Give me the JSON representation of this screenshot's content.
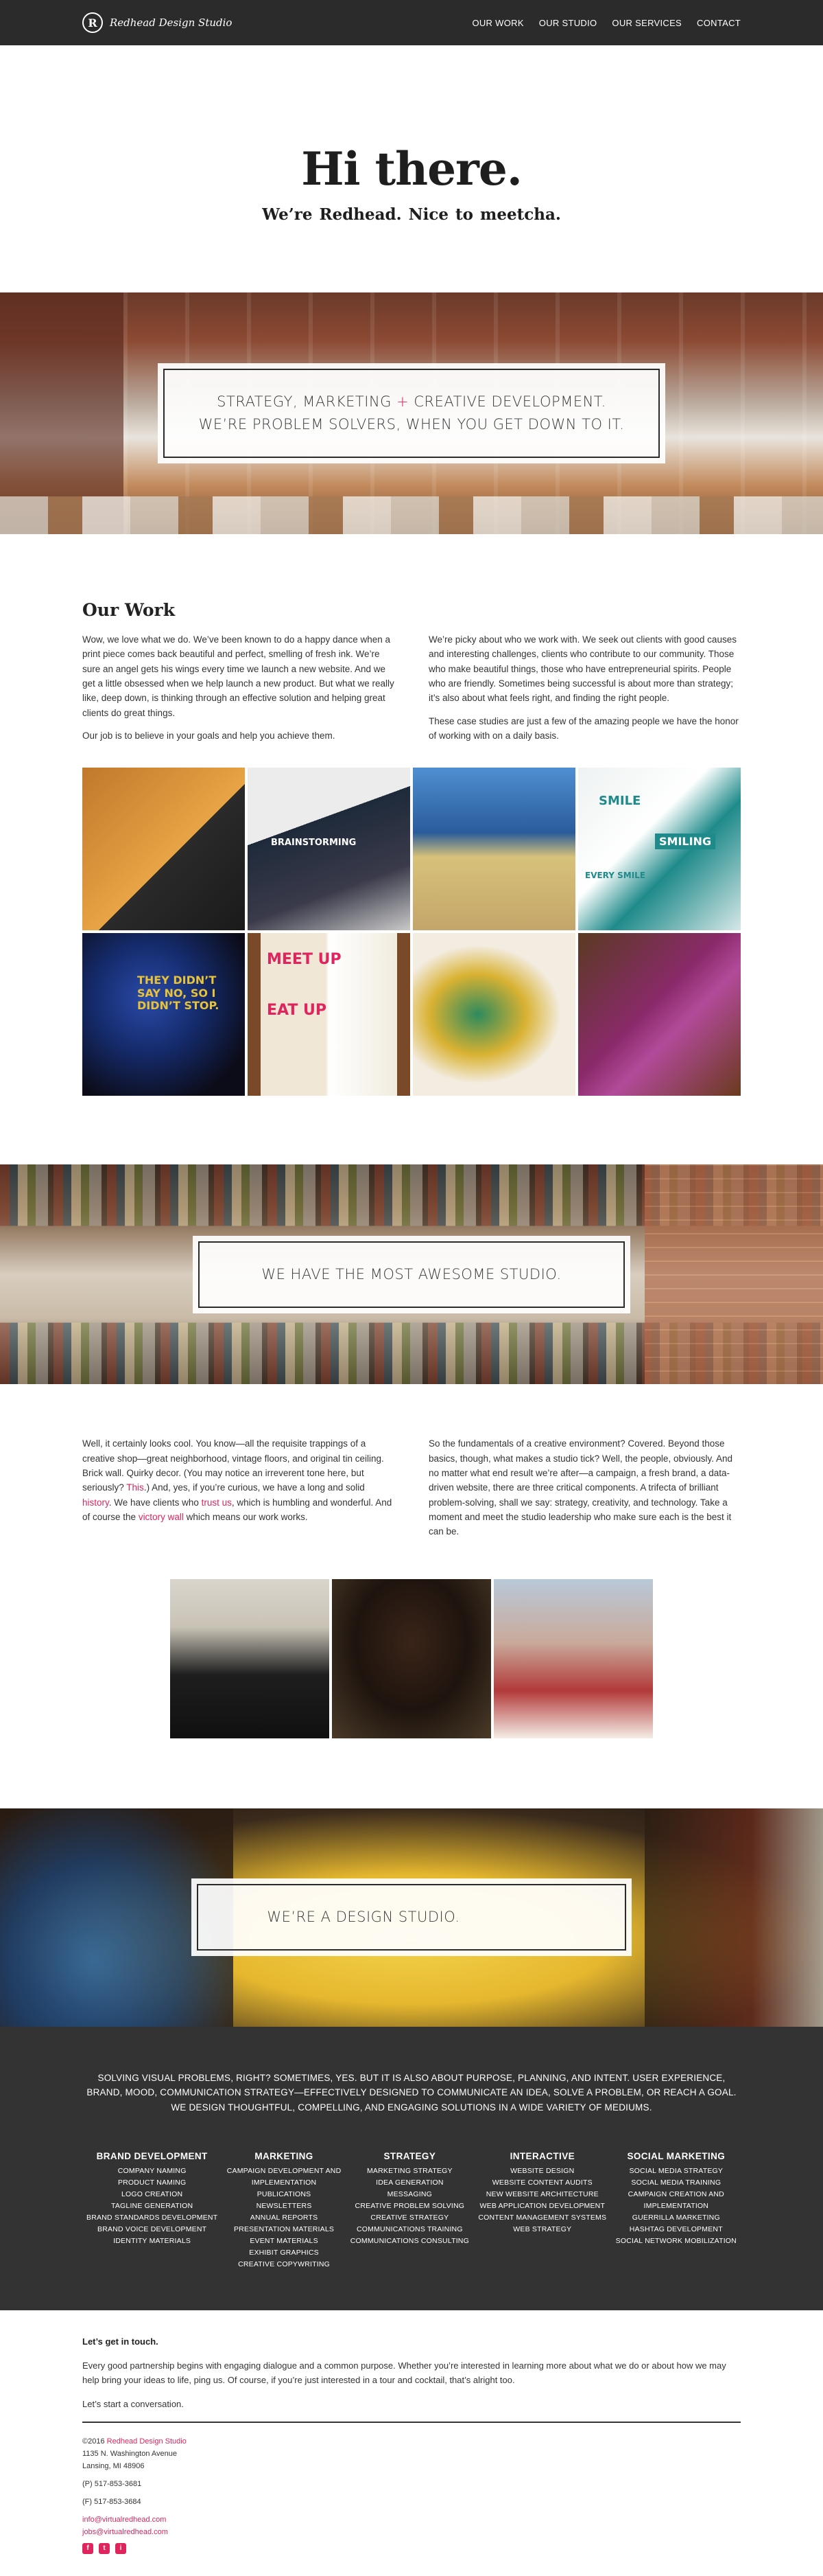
{
  "nav": {
    "brand": "Redhead Design Studio",
    "logo_letter": "R",
    "links": [
      "OUR WORK",
      "OUR STUDIO",
      "OUR SERVICES",
      "CONTACT"
    ]
  },
  "hero": {
    "title": "Hi there.",
    "subtitle": "We’re Redhead.  Nice to meetcha."
  },
  "banner1": {
    "line1_a": "STRATEGY, MARKETING ",
    "line1_plus": "+",
    "line1_b": " CREATIVE DEVELOPMENT.",
    "line2": "WE’RE PROBLEM SOLVERS, WHEN YOU GET DOWN TO IT."
  },
  "work": {
    "title": "Our Work",
    "left_p1": "Wow, we love what we do. We’ve been known to do a happy dance when a print piece comes back beautiful and perfect, smelling of fresh ink. We’re sure an angel gets his wings every time we launch a new website. And we get a little obsessed when we help launch a new product. But what we really like, deep down, is thinking through an effective solution and helping great clients do great things.",
    "left_p2": "Our job is to believe in your goals and help you achieve them.",
    "right_p1": "We’re picky about who we work with. We seek out clients with good causes and interesting challenges, clients who contribute to our community. Those who make beautiful things, those who have entrepreneurial spirits. People who are friendly. Sometimes being successful is about more than strategy; it’s also about what feels right, and finding the right people.",
    "right_p2": "These case studies are just a few of the amazing people we have the honor of working with on a daily basis.",
    "tile_texts": {
      "t2": "BRAINSTORMING",
      "t4a": "SMILE",
      "t4b": "SMILING",
      "t4c": "EVERY SMILE",
      "t5": "THEY DIDN’T SAY NO, SO I DIDN’T STOP.",
      "t6a": "MEET UP",
      "t6b": "EAT UP"
    }
  },
  "banner2": {
    "text": "WE HAVE THE MOST AWESOME STUDIO."
  },
  "studio": {
    "left_a": "Well, it certainly looks cool. You know—all the requisite trappings of a creative shop—great neighborhood, vintage floors, and original tin ceiling. Brick wall. Quirky decor. (You may notice an irreverent tone here, but seriously? ",
    "left_link1": "This",
    "left_b": ".) And, yes, if you’re curious, we have a long and solid ",
    "left_link2": "history",
    "left_c": ". We have clients who ",
    "left_link3": "trust us",
    "left_d": ", which is humbling and wonderful. And of course the ",
    "left_link4": "victory wall",
    "left_e": " which means our work works.",
    "right": "So the fundamentals of a creative environment? Covered. Beyond those basics, though, what makes a studio tick? Well, the people, obviously. And no matter what end result we’re after—a campaign, a fresh brand, a data-driven website, there are three critical components. A trifecta of brilliant problem-solving, shall we say: strategy, creativity, and technology. Take a moment and meet the studio leadership who make sure each is the best it can be."
  },
  "banner3": {
    "text": "WE’RE A DESIGN STUDIO."
  },
  "services": {
    "intro": "SOLVING VISUAL PROBLEMS, RIGHT? SOMETIMES, YES. BUT IT IS ALSO ABOUT PURPOSE, PLANNING, AND INTENT. USER EXPERIENCE, BRAND, MOOD, COMMUNICATION STRATEGY—EFFECTIVELY DESIGNED TO COMMUNICATE AN IDEA, SOLVE A PROBLEM, OR REACH A GOAL. WE DESIGN THOUGHTFUL, COMPELLING, AND ENGAGING SOLUTIONS IN A WIDE VARIETY OF MEDIUMS.",
    "columns": [
      {
        "title": "BRAND DEVELOPMENT",
        "items": [
          "COMPANY NAMING",
          "PRODUCT NAMING",
          "LOGO CREATION",
          "TAGLINE GENERATION",
          "BRAND STANDARDS DEVELOPMENT",
          "BRAND VOICE DEVELOPMENT",
          "IDENTITY MATERIALS"
        ]
      },
      {
        "title": "MARKETING",
        "items": [
          "CAMPAIGN DEVELOPMENT AND",
          "IMPLEMENTATION",
          "PUBLICATIONS",
          "NEWSLETTERS",
          "ANNUAL REPORTS",
          "PRESENTATION MATERIALS",
          "EVENT MATERIALS",
          "EXHIBIT GRAPHICS",
          "CREATIVE COPYWRITING"
        ]
      },
      {
        "title": "STRATEGY",
        "items": [
          "MARKETING STRATEGY",
          "IDEA GENERATION",
          "MESSAGING",
          "CREATIVE PROBLEM SOLVING",
          "CREATIVE STRATEGY",
          "COMMUNICATIONS TRAINING",
          "COMMUNICATIONS CONSULTING"
        ]
      },
      {
        "title": "INTERACTIVE",
        "items": [
          "WEBSITE DESIGN",
          "WEBSITE CONTENT AUDITS",
          "NEW WEBSITE ARCHITECTURE",
          "WEB APPLICATION DEVELOPMENT",
          "CONTENT MANAGEMENT SYSTEMS",
          "WEB STRATEGY"
        ]
      },
      {
        "title": "SOCIAL MARKETING",
        "items": [
          "SOCIAL MEDIA STRATEGY",
          "SOCIAL MEDIA TRAINING",
          "CAMPAIGN CREATION AND",
          "IMPLEMENTATION",
          "GUERRILLA MARKETING",
          "HASHTAG DEVELOPMENT",
          "SOCIAL NETWORK MOBILIZATION"
        ]
      }
    ]
  },
  "contact": {
    "heading": "Let’s get in touch.",
    "body": "Every good partnership begins with engaging dialogue and a common purpose. Whether you’re interested in learning more about what we do or about how we may help bring your ideas to life, ping us. Of course, if you’re just interested in a tour and cocktail, that’s alright too.",
    "cta": "Let’s start a conversation.",
    "copyright_prefix": "©2016 ",
    "copyright_link": "Redhead Design Studio",
    "address1": "1135 N. Washington Avenue",
    "address2": "Lansing, MI 48906",
    "phone": "(P) 517-853-3681",
    "fax": "(F) 517-853-3684",
    "email1": "info@virtualredhead.com",
    "email2": "jobs@virtualredhead.com",
    "socials": [
      "f",
      "t",
      "i"
    ],
    "accent": "#e0245e"
  }
}
